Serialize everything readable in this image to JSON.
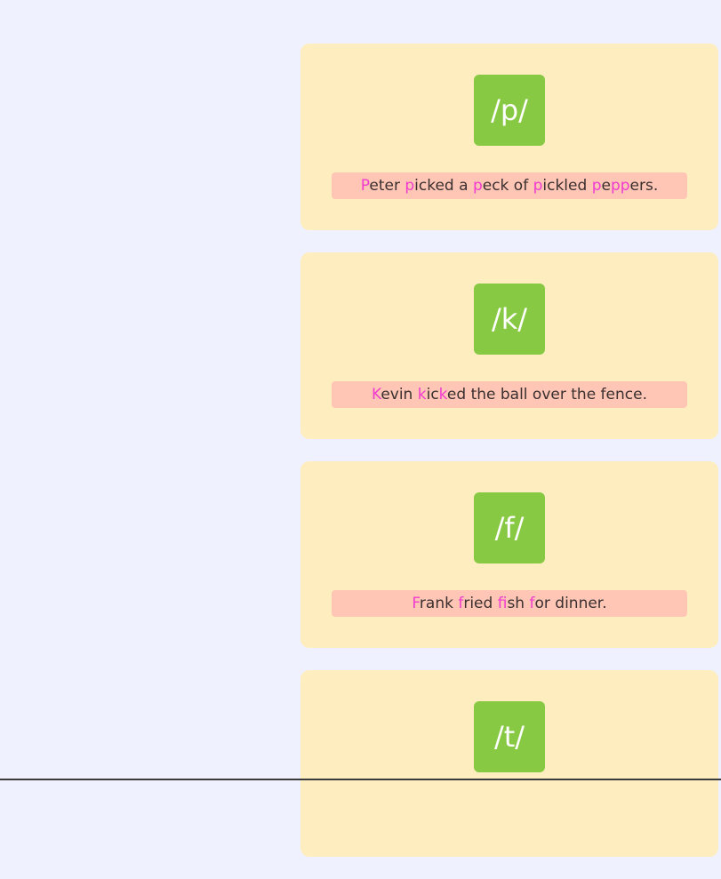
{
  "cards": [
    {
      "phoneme": "/p/",
      "segments": [
        {
          "text": "P",
          "hl": true
        },
        {
          "text": "eter ",
          "hl": false
        },
        {
          "text": "p",
          "hl": true
        },
        {
          "text": "icked a ",
          "hl": false
        },
        {
          "text": "p",
          "hl": true
        },
        {
          "text": "eck of ",
          "hl": false
        },
        {
          "text": "p",
          "hl": true
        },
        {
          "text": "ickled ",
          "hl": false
        },
        {
          "text": "p",
          "hl": true
        },
        {
          "text": "e",
          "hl": false
        },
        {
          "text": "pp",
          "hl": true
        },
        {
          "text": "ers.",
          "hl": false
        }
      ]
    },
    {
      "phoneme": "/k/",
      "segments": [
        {
          "text": "K",
          "hl": true
        },
        {
          "text": "evin ",
          "hl": false
        },
        {
          "text": "k",
          "hl": true
        },
        {
          "text": "ic",
          "hl": false
        },
        {
          "text": "k",
          "hl": true
        },
        {
          "text": "ed the ball over the fence.",
          "hl": false
        }
      ]
    },
    {
      "phoneme": "/f/",
      "segments": [
        {
          "text": "F",
          "hl": true
        },
        {
          "text": "rank ",
          "hl": false
        },
        {
          "text": "f",
          "hl": true
        },
        {
          "text": "ried ",
          "hl": false
        },
        {
          "text": "f",
          "hl": true
        },
        {
          "text": "ish ",
          "hl": false
        },
        {
          "text": "f",
          "hl": true
        },
        {
          "text": "or dinner.",
          "hl": false
        }
      ]
    },
    {
      "phoneme": "/t/",
      "segments": []
    }
  ],
  "colors": {
    "background": "#eff1fe",
    "card": "#feeebf",
    "tile": "#88c943",
    "sentence_bg": "#ffc6b5",
    "highlight": "#f03ccf"
  }
}
